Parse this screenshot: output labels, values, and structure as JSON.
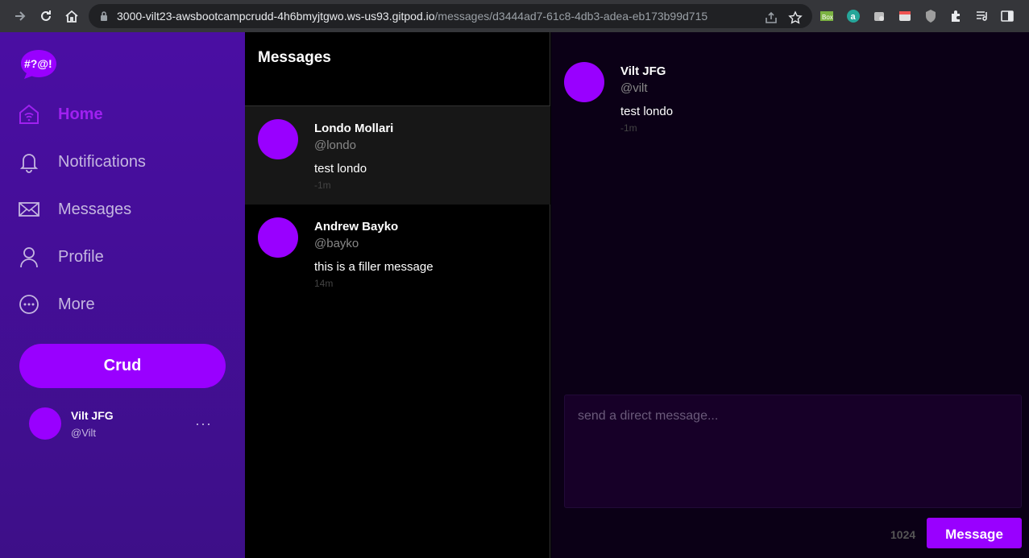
{
  "browser": {
    "url_host": "3000-vilt23-awsbootcampcrudd-4h6bmyjtgwo.ws-us93.gitpod.io",
    "url_path": "/messages/d3444ad7-61c8-4db3-adea-eb173b99d715",
    "extensions": [
      "box-extension-icon",
      "a-extension-icon",
      "puzzle-extension-icon"
    ],
    "extension_labels": {
      "box": "Box",
      "a": "a"
    }
  },
  "sidebar": {
    "logo_text": "#?@!",
    "items": [
      {
        "label": "Home",
        "icon": "home-icon",
        "active": true
      },
      {
        "label": "Notifications",
        "icon": "bell-icon",
        "active": false
      },
      {
        "label": "Messages",
        "icon": "envelope-icon",
        "active": false
      },
      {
        "label": "Profile",
        "icon": "user-icon",
        "active": false
      },
      {
        "label": "More",
        "icon": "more-circle-icon",
        "active": false
      }
    ],
    "crud_label": "Crud",
    "profile": {
      "name": "Vilt JFG",
      "handle": "@Vilt",
      "more": "···"
    }
  },
  "groups": {
    "title": "Messages",
    "items": [
      {
        "name": "Londo Mollari",
        "handle": "@londo",
        "message": "test londo",
        "time": "-1m"
      },
      {
        "name": "Andrew Bayko",
        "handle": "@bayko",
        "message": "this is a filler message",
        "time": "14m"
      }
    ]
  },
  "conversation": {
    "messages": [
      {
        "name": "Vilt JFG",
        "handle": "@vilt",
        "message": "test londo",
        "time": "-1m"
      }
    ],
    "compose_placeholder": "send a direct message...",
    "char_count": "1024",
    "send_label": "Message"
  },
  "colors": {
    "accent": "#9900ff",
    "sidebar_top": "#4a0ea3",
    "sidebar_bottom": "#3d0f88",
    "active_nav": "#a020f0",
    "conversation_bg": "#0b0016",
    "compose_bg": "#170028"
  }
}
